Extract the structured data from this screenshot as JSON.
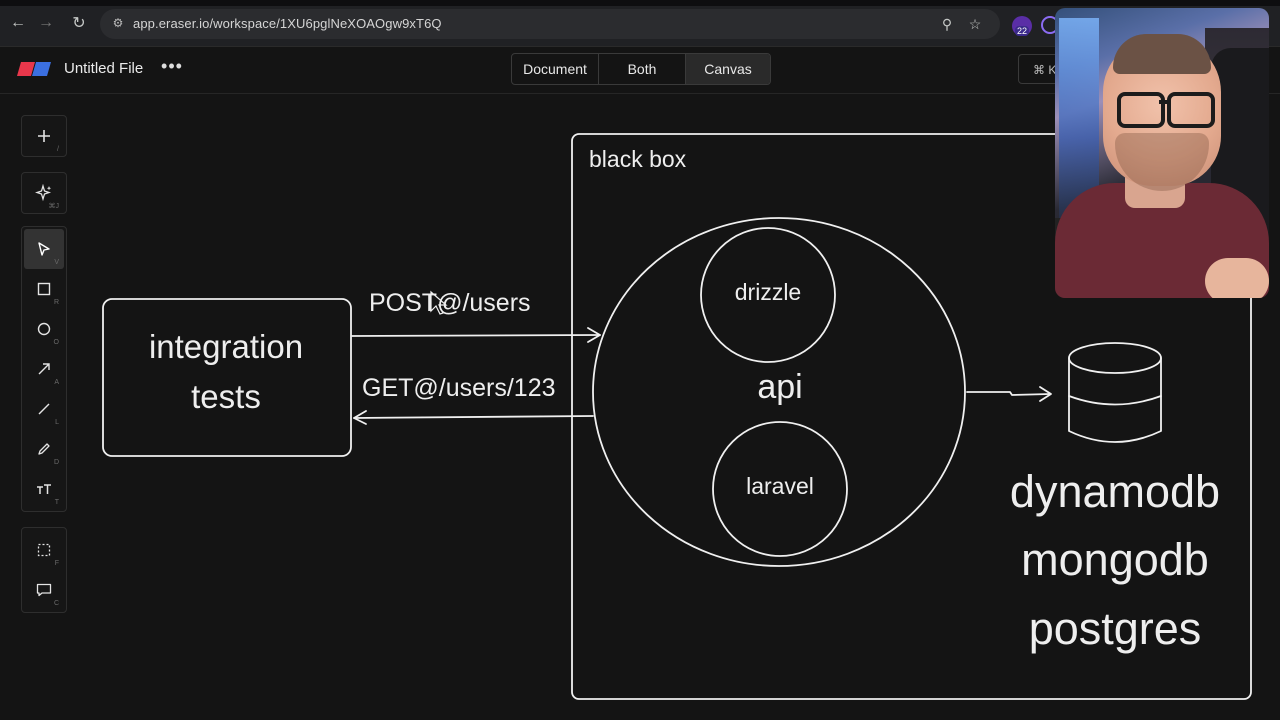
{
  "browser": {
    "url": "app.eraser.io/workspace/1XU6pglNeXOAOgw9xT6Q",
    "extension_badge": "22"
  },
  "header": {
    "file_title": "Untitled File",
    "modes": [
      "Document",
      "Both",
      "Canvas"
    ],
    "active_mode": "Canvas",
    "command_hint": "⌘ K"
  },
  "toolbar": {
    "hints": {
      "add": "/",
      "ai": "⌘J",
      "select": "V",
      "rectangle": "R",
      "ellipse": "O",
      "arrow": "A",
      "line": "L",
      "pen": "D",
      "text": "T",
      "frame": "F",
      "comment": "C"
    }
  },
  "diagram": {
    "integration_tests": [
      "integration",
      "tests"
    ],
    "post_label": "POST@/users",
    "get_label": "GET@/users/123",
    "black_box_label": "black box",
    "api_label": "api",
    "drizzle_label": "drizzle",
    "laravel_label": "laravel",
    "databases": [
      "dynamodb",
      "mongodb",
      "postgres"
    ]
  },
  "colors": {
    "background": "#141414",
    "stroke": "#f0f0f0",
    "brand_red": "#e8374b",
    "brand_blue": "#3b6fe0"
  }
}
